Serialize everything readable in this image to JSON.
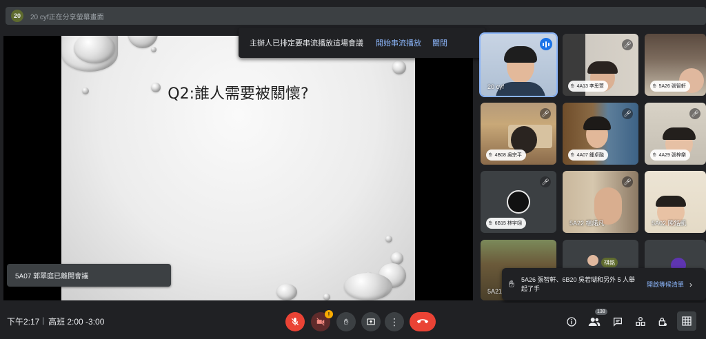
{
  "topbar": {
    "presenter_avatar": "20",
    "presenter_text": "20 cyf正在分享螢幕畫面"
  },
  "stream_banner": {
    "text": "主辦人已排定要串流播放這場會議",
    "start_label": "開始串流播放",
    "close_label": "關閉"
  },
  "slide": {
    "title": "Q2:誰人需要被關懷?"
  },
  "leave_notice": "5A07 郭翠庭已離開會議",
  "participants": [
    {
      "name": "20 cyf",
      "hand": false
    },
    {
      "name": "4A13 李思萱",
      "hand": true
    },
    {
      "name": "5A26 張智軒",
      "hand": true
    },
    {
      "name": "4B08 吳宗平",
      "hand": true
    },
    {
      "name": "4A07 鍾卓融",
      "hand": true
    },
    {
      "name": "4A29 張梓樂",
      "hand": true
    },
    {
      "name": "6B15 林宇翊",
      "hand": true
    },
    {
      "name": "5A22 楊諾凡",
      "hand": false
    },
    {
      "name": "5A02 陳銘凱",
      "hand": false
    },
    {
      "name": "5A21",
      "hand": false
    },
    {
      "name": "祺銘",
      "hand": false
    }
  ],
  "hand_toast": {
    "text": "5A26 張智軒、6B20 吳若瑚和另外 5 人舉起了手",
    "button": "開啟等候清單"
  },
  "bottombar": {
    "time": "下午2:17",
    "separator": "|",
    "meeting_name": "高班 2:00 -3:00",
    "people_count": "138",
    "camera_warning": "!"
  },
  "icons": {
    "mic": "mic-off-icon",
    "camera": "camera-off-icon",
    "hand": "raise-hand-icon",
    "present": "present-icon",
    "more": "more-vert-icon",
    "end": "end-call-icon",
    "info": "info-icon",
    "people": "people-icon",
    "chat": "chat-icon",
    "activities": "activities-icon",
    "host": "host-controls-icon",
    "grid": "grid-view-icon"
  },
  "colors": {
    "background": "#202124",
    "accent": "#8ab4f8",
    "danger": "#ea4335",
    "warning": "#f9ab00"
  }
}
